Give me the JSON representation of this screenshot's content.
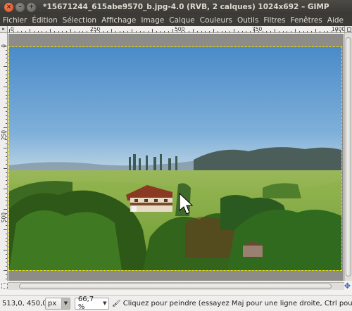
{
  "window": {
    "title": "*15671244_615abe9570_b.jpg-4.0 (RVB, 2 calques) 1024x692 – GIMP",
    "close_glyph": "×",
    "minimize_glyph": "–",
    "maximize_glyph": "+"
  },
  "menu": {
    "items": [
      "Fichier",
      "Édition",
      "Sélection",
      "Affichage",
      "Image",
      "Calque",
      "Couleurs",
      "Outils",
      "Filtres",
      "Fenêtres",
      "Aide"
    ]
  },
  "ruler": {
    "h_labels": [
      "0",
      "250",
      "500",
      "750",
      "1000"
    ],
    "v_labels": [
      "0",
      "250",
      "500"
    ]
  },
  "statusbar": {
    "coords": "513,0, 450,0",
    "unit": "px",
    "zoom": "66,7 %",
    "message": "Cliquez pour peindre (essayez Maj pour une ligne droite, Ctrl pour c..."
  },
  "colors": {
    "sky_top": "#4d8fcc",
    "sky_horizon": "#b4cfe0",
    "field": "#7fae3a",
    "foliage": "#2f5e1a",
    "selection_outline": "#e8e600"
  },
  "icons": {
    "cursor": "arrow-cursor-icon",
    "tool": "paintbrush-icon",
    "navigate": "navigate-icon"
  }
}
